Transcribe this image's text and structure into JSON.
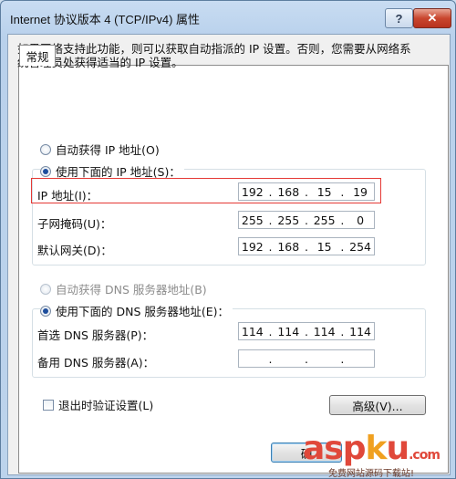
{
  "window": {
    "title": "Internet 协议版本 4 (TCP/IPv4) 属性"
  },
  "titlebar": {
    "help_label": "?",
    "close_label": "✕"
  },
  "tab": {
    "general": "常规"
  },
  "description": "如果网络支持此功能，则可以获取自动指派的 IP 设置。否则，您需要从网络系统管理员处获得适当的 IP 设置。",
  "ip_section": {
    "auto_label": "自动获得 IP 地址(O)",
    "manual_label": "使用下面的 IP 地址(S)：",
    "selected": "manual",
    "fields": [
      {
        "label": "IP 地址(I)：",
        "octets": [
          "192",
          "168",
          "15",
          "19"
        ]
      },
      {
        "label": "子网掩码(U)：",
        "octets": [
          "255",
          "255",
          "255",
          "0"
        ]
      },
      {
        "label": "默认网关(D)：",
        "octets": [
          "192",
          "168",
          "15",
          "254"
        ]
      }
    ]
  },
  "dns_section": {
    "auto_label": "自动获得 DNS 服务器地址(B)",
    "manual_label": "使用下面的 DNS 服务器地址(E)：",
    "selected": "manual",
    "fields": [
      {
        "label": "首选 DNS 服务器(P)：",
        "octets": [
          "114",
          "114",
          "114",
          "114"
        ]
      },
      {
        "label": "备用 DNS 服务器(A)：",
        "octets": [
          "",
          "",
          "",
          ""
        ]
      }
    ]
  },
  "validate_on_exit": {
    "label": "退出时验证设置(L)",
    "checked": false
  },
  "buttons": {
    "advanced": "高级(V)...",
    "ok": "确"
  },
  "watermark": {
    "logo_main": "asp",
    "logo_k": "k",
    "logo_u": "u",
    "logo_suffix": ".com",
    "tagline": "免费网站源码下载站!"
  },
  "colors": {
    "highlight": "#e53935",
    "title_bg": "#c8dcf2"
  }
}
